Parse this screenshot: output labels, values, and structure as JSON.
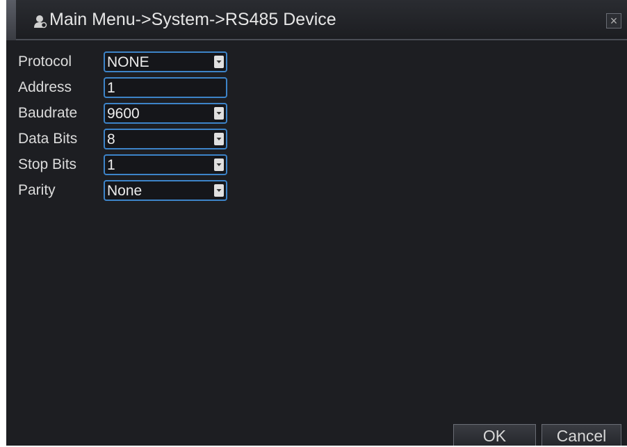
{
  "window": {
    "title": "Main Menu->System->RS485 Device",
    "close_label": "×"
  },
  "form": {
    "rows": [
      {
        "label": "Protocol",
        "value": "NONE",
        "type": "dropdown"
      },
      {
        "label": "Address",
        "value": "1",
        "type": "text"
      },
      {
        "label": "Baudrate",
        "value": "9600",
        "type": "dropdown"
      },
      {
        "label": "Data Bits",
        "value": "8",
        "type": "dropdown"
      },
      {
        "label": "Stop Bits",
        "value": "1",
        "type": "dropdown"
      },
      {
        "label": "Parity",
        "value": "None",
        "type": "dropdown"
      }
    ]
  },
  "footer": {
    "ok_label": "OK",
    "cancel_label": "Cancel"
  },
  "colors": {
    "background": "#1d1e22",
    "field_border": "#3d84c9",
    "text": "#dcdcdc"
  },
  "icons": {
    "title": "user-settings-icon",
    "close": "close-icon",
    "dropdown": "chevron-down-icon"
  }
}
